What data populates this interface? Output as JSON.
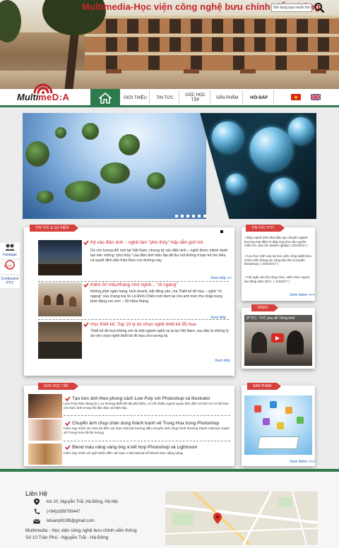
{
  "header": {
    "site_title": "Multimedia-Học viện công nghệ bưu chính viễn thông",
    "search_placeholder": "Nội dung bạn muốn tìm kiếm...",
    "logo_line1": "Multi",
    "logo_line2": "meD:A"
  },
  "nav": {
    "items": [
      "GIỚI THIỆU",
      "TIN TỨC",
      "GÓC HỌC TẬP",
      "SẢN PHẨM",
      "HỎI ĐÁP"
    ]
  },
  "side": {
    "fanpage": "Fanpage",
    "ptit": "PTIT",
    "confession": "Confession PTIT"
  },
  "news": {
    "tab": "TIN TỨC & SỰ KIỆN",
    "items": [
      {
        "title": "Kỹ xảo điện ảnh – nghề làm \"phù thủy\" hấp dẫn giới trẻ.",
        "body": "Dù còn tương đối mới tại Việt Nam, nhưng kỹ xảo điện ảnh – nghề được mệnh danh tạo nên những \"phù thủy\" của điện ảnh hiện đại đã thu hút không ít bạn trẻ tìm hiểu và quyết định dấn thân theo con đường này.",
        "more": "Xem tiếp >>"
      },
      {
        "title": "Kiếm 50 triệu/tháng nhờ nghề... \"rẽ ngang\"",
        "body": "Không phải ngân hàng, kinh doanh, bất động sản, mà Thiết kế đồ họa – nghề \"rẽ ngang\" của chàng trai 9x Lê Đình Chiến mới đem lại cho anh mức thu nhập trung bình đáng mơ ước – 50 triệu/ tháng.",
        "more": "Xem tiếp"
      },
      {
        "title": "Học thiết kế: Top 10 lý do chọn nghề thiết kế đồ họa",
        "body": "Thiết kế đồ họa không còn là một ngành nghề xa lạ tại Việt Nam, sau đây là những lý do nên chọn nghề thiết kế đồ họa cho tương lai.",
        "more": "Xem tiếp"
      }
    ]
  },
  "ptit_news": {
    "tab": "TIN TỨC PTIT",
    "items": [
      "Đẩy mạnh triển khai đào tạo chuyên ngành thương mại điện tử đáp ứng nhu cầu nguồn nhân lực của các doanh nghiệp ( 10/4/2017 )",
      "Lưu học sinh Lào tại Học viện công nghệ bưu chính viễn thông rộn ràng đón tết cổ truyền Bunpimay. ( 10/4/2017 )",
      "Hội nghị cán bộ công chức, viên chức người lao động năm 2017. ( 7/4/2017 )"
    ],
    "more": "Xem thêm >>>"
  },
  "video": {
    "tab": "VIDEO",
    "caption": "[PTIT] - TVC phụ đề Tiếng Anh"
  },
  "study": {
    "tab": "GÓC HỌC TẬP",
    "items": [
      {
        "title": "Tạo bức ảnh theo phong cách Low Poly với Photoshop và Illustrator",
        "body": "Low Poly hiện đang là 1 xu hướng thiết kế rất phổ biến, có rất nhiều người quan tâm đến nó bởi nó có thể làm cho bức ảnh trong rất độc đáo và hiện đại."
      },
      {
        "title": "Chuyển ảnh chụp chân dung thành tranh vẽ Trung Hoa trong Photoshop",
        "body": "Hôm nay mình xin chia sẻ đến các bạn một bài hướng dẫn chuyển ảnh chụp bình thường thành một bức tranh vẽ Trung Hoa rất ấn tượng."
      },
      {
        "title": "Blend màu nâng vàng óng á kết hợp Photoshop và Lightroom",
        "body": "Hôm nay mình xin giới thiệu đến các bạn 1 bài tutorial về blend màu nâng vàng."
      }
    ]
  },
  "products": {
    "tab": "SẢN PHẨM",
    "more": "Xem thêm >>>"
  },
  "footer": {
    "heading": "Liên Hệ",
    "address": "km 10 ,Nguyễn Trãi ,Hà Đông, Hà Nội",
    "phone": "(+84)1659790447",
    "email": "letuanptit195@gmail.com",
    "org": "Multimedia - Học viện công nghệ bưu chính viễn thông",
    "org_address": "Số 10 Trần Phú - Nguyễn Trãi - Hà Đông"
  },
  "colors": {
    "accent_green": "#2d7a4d",
    "accent_red": "#d6403d",
    "link_blue": "#1a5cb8"
  }
}
